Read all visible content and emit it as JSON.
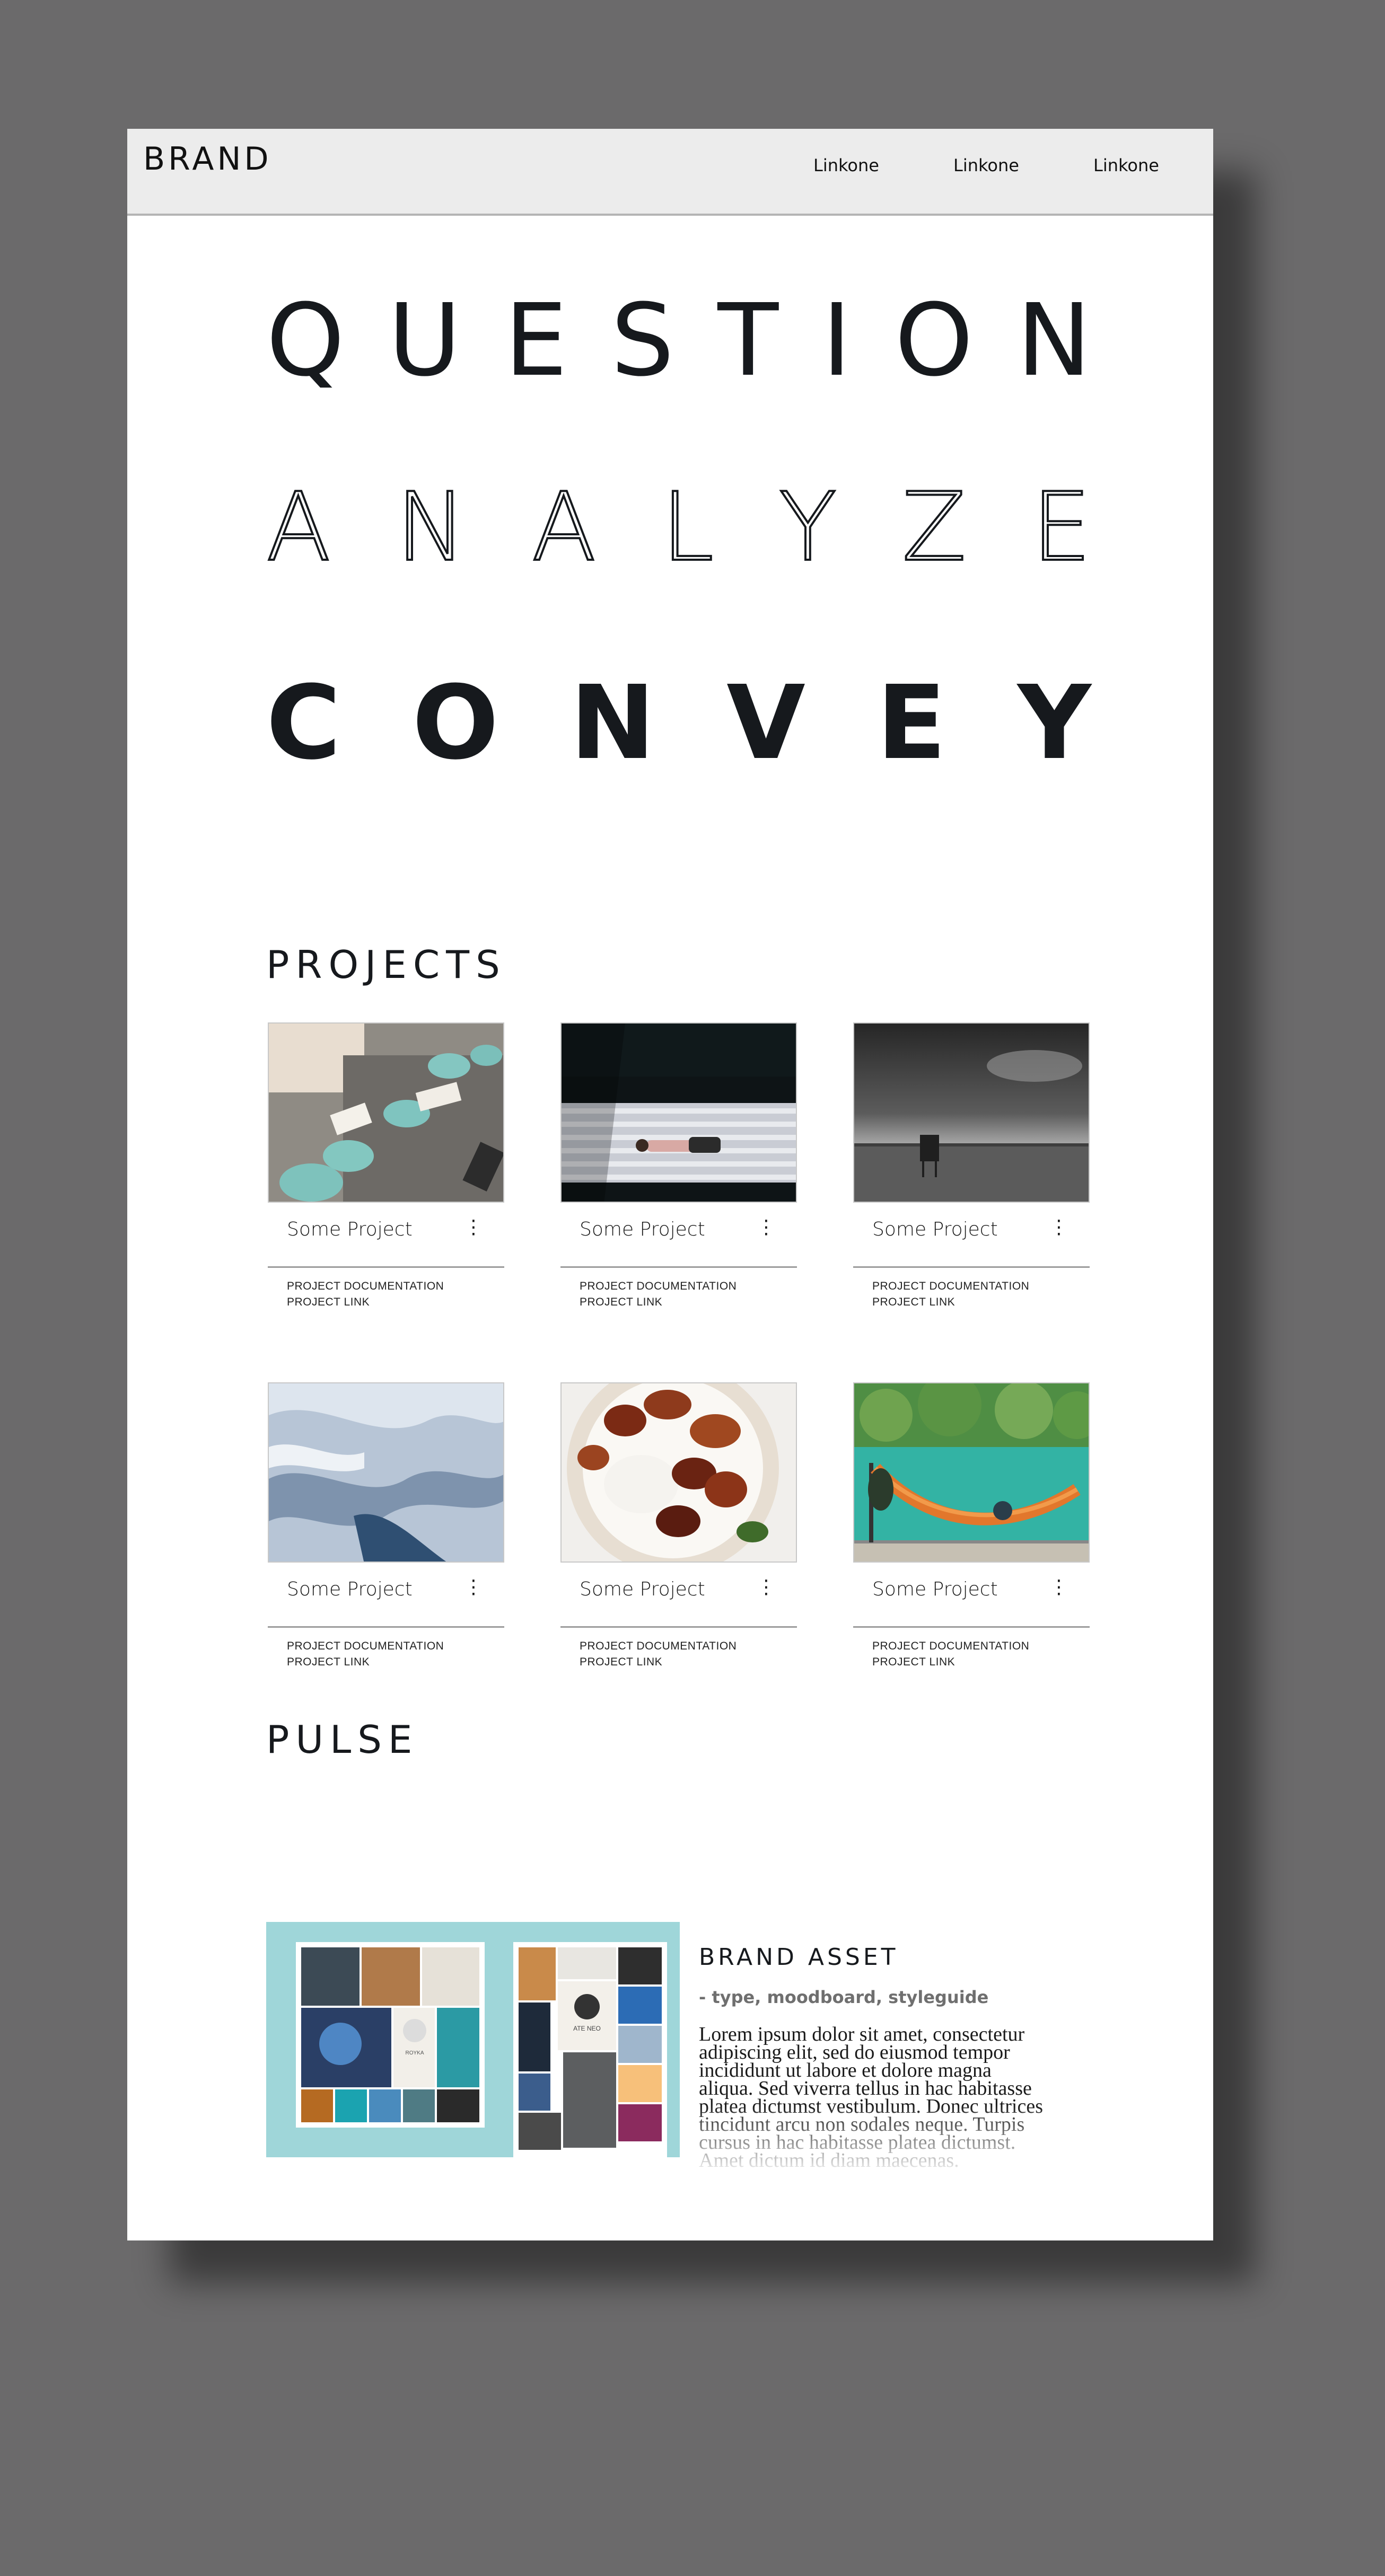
{
  "header": {
    "brand": "BRAND",
    "links": [
      "Linkone",
      "Linkone",
      "Linkone"
    ]
  },
  "hero": {
    "words": [
      "QUESTION",
      "ANALYZE",
      "CONVEY"
    ]
  },
  "projects": {
    "title": "PROJECTS",
    "items": [
      {
        "title": "Some Project",
        "doc": "PROJECT DOCUMENTATION",
        "link": "PROJECT LINK",
        "image": "cafe-table-photo"
      },
      {
        "title": "Some Project",
        "doc": "PROJECT DOCUMENTATION",
        "link": "PROJECT LINK",
        "image": "person-on-bench-photo"
      },
      {
        "title": "Some Project",
        "doc": "PROJECT DOCUMENTATION",
        "link": "PROJECT LINK",
        "image": "stormy-beach-photo"
      },
      {
        "title": "Some Project",
        "doc": "PROJECT DOCUMENTATION",
        "link": "PROJECT LINK",
        "image": "ice-texture-photo"
      },
      {
        "title": "Some Project",
        "doc": "PROJECT DOCUMENTATION",
        "link": "PROJECT LINK",
        "image": "food-plate-photo"
      },
      {
        "title": "Some Project",
        "doc": "PROJECT DOCUMENTATION",
        "link": "PROJECT LINK",
        "image": "hammock-river-photo"
      }
    ],
    "more_icon": "⋮"
  },
  "pulse": {
    "title": "PULSE",
    "asset_title": "BRAND ASSET",
    "asset_subtitle": "- type, moodboard, styleguide",
    "asset_body": "Lorem ipsum dolor sit amet, consectetur adipiscing elit, sed do eiusmod tempor incididunt ut labore et dolore magna aliqua. Sed viverra tellus in hac habitasse platea dictumst vestibulum. Donec ultrices tincidunt arcu non sodales neque. Turpis cursus in hac habitasse platea dictumst. Amet dictum id diam maecenas.",
    "moodboard_labels": [
      "ROYKA",
      "ATE NEO"
    ]
  },
  "colors": {
    "background": "#6b6a6b",
    "topbar": "#ececec",
    "text": "#16191d",
    "moodboard_bg": "#9fd6d9"
  }
}
